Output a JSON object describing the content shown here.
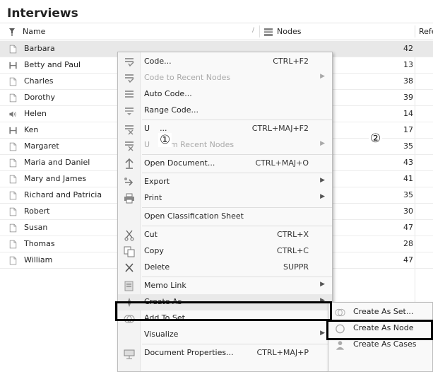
{
  "title": "Interviews",
  "columns": {
    "name": "Name",
    "nodes": "Nodes",
    "references": "Refe"
  },
  "rows": [
    {
      "name": "Barbara",
      "nodes": "42",
      "icon": "document-icon",
      "selected": true
    },
    {
      "name": "Betty and Paul",
      "nodes": "13",
      "icon": "video-icon"
    },
    {
      "name": "Charles",
      "nodes": "38",
      "icon": "document-icon"
    },
    {
      "name": "Dorothy",
      "nodes": "39",
      "icon": "document-icon"
    },
    {
      "name": "Helen",
      "nodes": "14",
      "icon": "audio-icon"
    },
    {
      "name": "Ken",
      "nodes": "17",
      "icon": "video-icon"
    },
    {
      "name": "Margaret",
      "nodes": "35",
      "icon": "document-icon"
    },
    {
      "name": "Maria and Daniel",
      "nodes": "43",
      "icon": "document-icon"
    },
    {
      "name": "Mary and James",
      "nodes": "41",
      "icon": "document-icon"
    },
    {
      "name": "Richard and Patricia",
      "nodes": "35",
      "icon": "document-icon"
    },
    {
      "name": "Robert",
      "nodes": "30",
      "icon": "document-icon"
    },
    {
      "name": "Susan",
      "nodes": "47",
      "icon": "document-icon"
    },
    {
      "name": "Thomas",
      "nodes": "28",
      "icon": "document-icon"
    },
    {
      "name": "William",
      "nodes": "47",
      "icon": "document-icon"
    }
  ],
  "context_menu": [
    {
      "label": "Code...",
      "shortcut": "CTRL+F2",
      "icon": "code-icon"
    },
    {
      "label": "Code to Recent Nodes",
      "submenu": true,
      "disabled": true,
      "icon": "code-recent-icon"
    },
    {
      "label": "Auto Code...",
      "icon": "auto-code-icon"
    },
    {
      "label": "Range Code...",
      "icon": "range-code-icon"
    },
    {
      "sep": true
    },
    {
      "label": "U",
      "label_suffix": "...",
      "shortcut": "CTRL+MAJ+F2",
      "icon": "uncode-icon"
    },
    {
      "label": "U",
      "label_suffix": "from Recent Nodes",
      "submenu": true,
      "disabled": true,
      "icon": "uncode-recent-icon"
    },
    {
      "sep": true
    },
    {
      "label": "Open Document...",
      "shortcut": "CTRL+MAJ+O",
      "icon": "open-document-icon"
    },
    {
      "sep": true
    },
    {
      "label": "Export",
      "submenu": true,
      "icon": "export-icon"
    },
    {
      "label": "Print",
      "submenu": true,
      "icon": "print-icon"
    },
    {
      "sep": true
    },
    {
      "label": "Open Classification Sheet"
    },
    {
      "sep": true
    },
    {
      "label": "Cut",
      "shortcut": "CTRL+X",
      "icon": "scissors-icon"
    },
    {
      "label": "Copy",
      "shortcut": "CTRL+C",
      "icon": "copy-icon"
    },
    {
      "label": "Delete",
      "shortcut": "SUPPR",
      "icon": "delete-icon"
    },
    {
      "sep": true
    },
    {
      "label": "Memo Link",
      "submenu": true,
      "icon": "memo-link-icon"
    },
    {
      "label": "Create As",
      "submenu": true,
      "icon": "create-as-icon",
      "highlight": true
    },
    {
      "label": "Add To Set...",
      "icon": "add-to-set-icon"
    },
    {
      "label": "Visualize",
      "submenu": true
    },
    {
      "sep": true
    },
    {
      "label": "Document Properties...",
      "shortcut": "CTRL+MAJ+P",
      "icon": "properties-icon"
    }
  ],
  "submenu": [
    {
      "label": "Create As Set...",
      "icon": "set-icon"
    },
    {
      "label": "Create As Node",
      "icon": "node-icon"
    },
    {
      "label": "Create As Cases",
      "icon": "cases-icon"
    }
  ],
  "markers": {
    "one": "①",
    "two": "②"
  },
  "colors": {
    "box": "#000000",
    "selected_row": "#e8e8e8",
    "menu_bg": "#f9f9f9"
  }
}
